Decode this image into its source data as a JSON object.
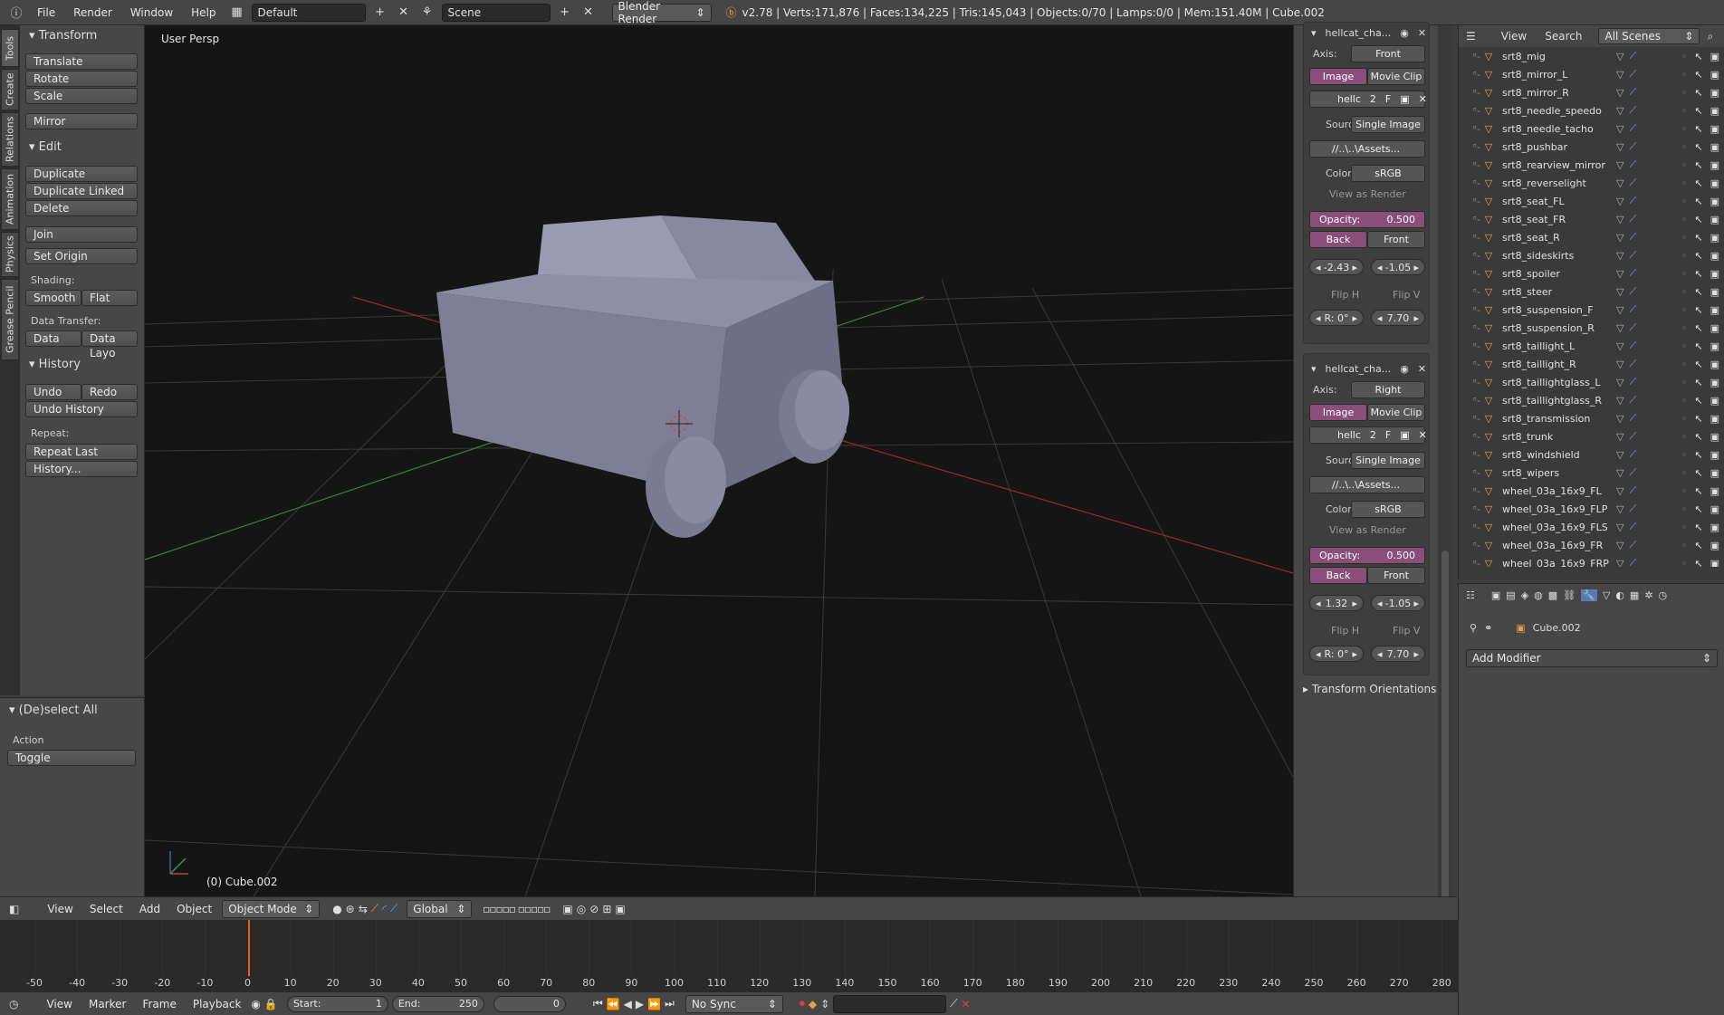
{
  "topbar": {
    "menus": [
      "File",
      "Render",
      "Window",
      "Help"
    ],
    "layout": "Default",
    "scene": "Scene",
    "engine": "Blender Render",
    "stats": "v2.78 | Verts:171,876 | Faces:134,225 | Tris:145,043 | Objects:0/70 | Lamps:0/0 | Mem:151.40M | Cube.002"
  },
  "tabs": [
    "Tools",
    "Create",
    "Relations",
    "Animation",
    "Physics",
    "Grease Pencil"
  ],
  "toolshelf": {
    "transform_title": "Transform",
    "translate": "Translate",
    "rotate": "Rotate",
    "scale": "Scale",
    "mirror": "Mirror",
    "edit_title": "Edit",
    "duplicate": "Duplicate",
    "duplicate_linked": "Duplicate Linked",
    "delete": "Delete",
    "join": "Join",
    "set_origin": "Set Origin",
    "shading_label": "Shading:",
    "smooth": "Smooth",
    "flat": "Flat",
    "data_transfer_label": "Data Transfer:",
    "data": "Data",
    "data_layo": "Data Layo",
    "history_title": "History",
    "undo": "Undo",
    "redo": "Redo",
    "undo_history": "Undo History",
    "repeat_label": "Repeat:",
    "repeat_last": "Repeat Last",
    "history": "History..."
  },
  "operator": {
    "title": "(De)select All",
    "action_label": "Action",
    "action_value": "Toggle"
  },
  "viewport": {
    "view_name": "User Persp",
    "object_label": "(0) Cube.002"
  },
  "npanel": {
    "images": [
      {
        "title": "hellcat_cha...",
        "axis_label": "Axis:",
        "axis": "Front",
        "image": "Image",
        "movie": "Movie Clip",
        "img_name": "hellc",
        "users": "2",
        "fake": "F",
        "source_label": "Source",
        "source": "Single Image",
        "path": "//..\\..\\Assets...",
        "color_label": "Color",
        "color": "sRGB",
        "view_as_render": "View as Render",
        "opacity_label": "Opacity:",
        "opacity": "0.500",
        "back": "Back",
        "front": "Front",
        "offset_x": "-2.43",
        "offset_y": "-1.05",
        "flip_h": "Flip H",
        "flip_v": "Flip V",
        "rotation": "R: 0°",
        "size": "7.70"
      },
      {
        "title": "hellcat_cha...",
        "axis_label": "Axis:",
        "axis": "Right",
        "image": "Image",
        "movie": "Movie Clip",
        "img_name": "hellc",
        "users": "2",
        "fake": "F",
        "source_label": "Source",
        "source": "Single Image",
        "path": "//..\\..\\Assets...",
        "color_label": "Color",
        "color": "sRGB",
        "view_as_render": "View as Render",
        "opacity_label": "Opacity:",
        "opacity": "0.500",
        "back": "Back",
        "front": "Front",
        "offset_x": "1.32",
        "offset_y": "-1.05",
        "flip_h": "Flip H",
        "flip_v": "Flip V",
        "rotation": "R: 0°",
        "size": "7.70"
      }
    ],
    "transform_orientations": "Transform Orientations"
  },
  "outliner": {
    "view": "View",
    "search": "Search",
    "filter": "All Scenes",
    "items": [
      "srt8_mig",
      "srt8_mirror_L",
      "srt8_mirror_R",
      "srt8_needle_speedo",
      "srt8_needle_tacho",
      "srt8_pushbar",
      "srt8_rearview_mirror",
      "srt8_reverselight",
      "srt8_seat_FL",
      "srt8_seat_FR",
      "srt8_seat_R",
      "srt8_sideskirts",
      "srt8_spoiler",
      "srt8_steer",
      "srt8_suspension_F",
      "srt8_suspension_R",
      "srt8_taillight_L",
      "srt8_taillight_R",
      "srt8_taillightglass_L",
      "srt8_taillightglass_R",
      "srt8_transmission",
      "srt8_trunk",
      "srt8_windshield",
      "srt8_wipers",
      "wheel_03a_16x9_FL",
      "wheel_03a_16x9_FLP",
      "wheel_03a_16x9_FLS",
      "wheel_03a_16x9_FR",
      "wheel_03a_16x9_FRP"
    ]
  },
  "properties": {
    "object": "Cube.002",
    "add_modifier": "Add Modifier"
  },
  "vpheader": {
    "menus": [
      "View",
      "Select",
      "Add",
      "Object"
    ],
    "mode": "Object Mode",
    "orientation": "Global"
  },
  "timeline": {
    "ticks": [
      "-50",
      "-40",
      "-30",
      "-20",
      "-10",
      "0",
      "10",
      "20",
      "30",
      "40",
      "50",
      "60",
      "70",
      "80",
      "90",
      "100",
      "110",
      "120",
      "130",
      "140",
      "150",
      "160",
      "170",
      "180",
      "190",
      "200",
      "210",
      "220",
      "230",
      "240",
      "250",
      "260",
      "270",
      "280"
    ],
    "current_frame_value": 0
  },
  "tlheader": {
    "menus": [
      "View",
      "Marker",
      "Frame",
      "Playback"
    ],
    "start": "Start:",
    "start_val": "1",
    "end": "End:",
    "end_val": "250",
    "current": "0",
    "sync": "No Sync"
  }
}
